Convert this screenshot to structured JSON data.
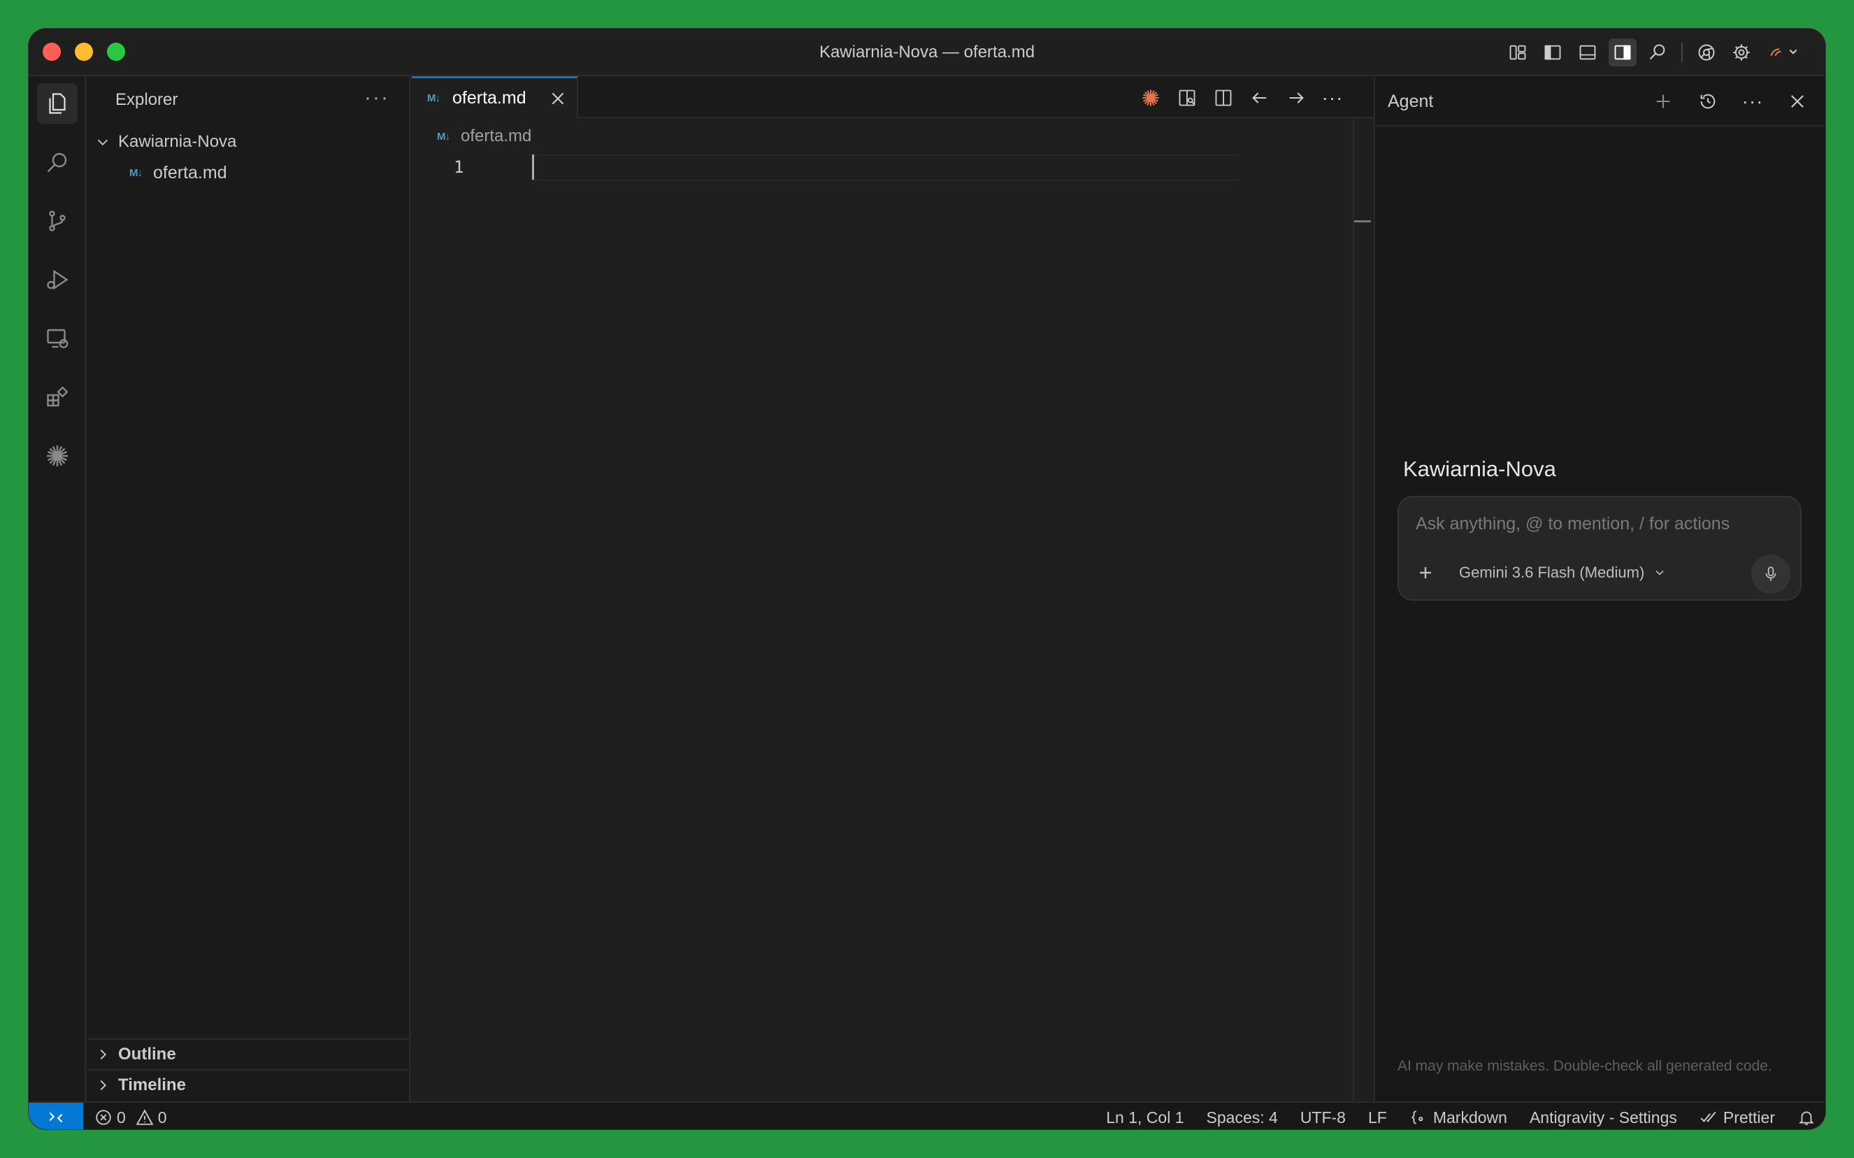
{
  "window": {
    "title": "Kawiarnia-Nova — oferta.md"
  },
  "explorer": {
    "title": "Explorer",
    "more": "···",
    "root_folder": "Kawiarnia-Nova",
    "files": [
      {
        "name": "oferta.md",
        "icon": "markdown-icon"
      }
    ],
    "sections": {
      "outline": "Outline",
      "timeline": "Timeline"
    }
  },
  "editor": {
    "tab_label": "oferta.md",
    "md_badge": "M↓",
    "breadcrumb": "oferta.md",
    "line_numbers": [
      "1"
    ],
    "more": "···"
  },
  "agent": {
    "title": "Agent",
    "more": "···",
    "project": "Kawiarnia-Nova",
    "input_placeholder": "Ask anything, @ to mention, / for actions",
    "model": "Gemini 3.6 Flash (Medium)",
    "disclaimer": "AI may make mistakes. Double-check all generated code."
  },
  "statusbar": {
    "errors": "0",
    "warnings": "0",
    "position": "Ln 1, Col 1",
    "spaces": "Spaces: 4",
    "encoding": "UTF-8",
    "eol": "LF",
    "language": "Markdown",
    "settings": "Antigravity - Settings",
    "prettier": "Prettier"
  },
  "colors": {
    "accent": "#0078d4",
    "background": "#1f1f1f",
    "desktop": "#23963f",
    "markdown_icon": "#519aba",
    "agent_star": "#e8744f"
  }
}
